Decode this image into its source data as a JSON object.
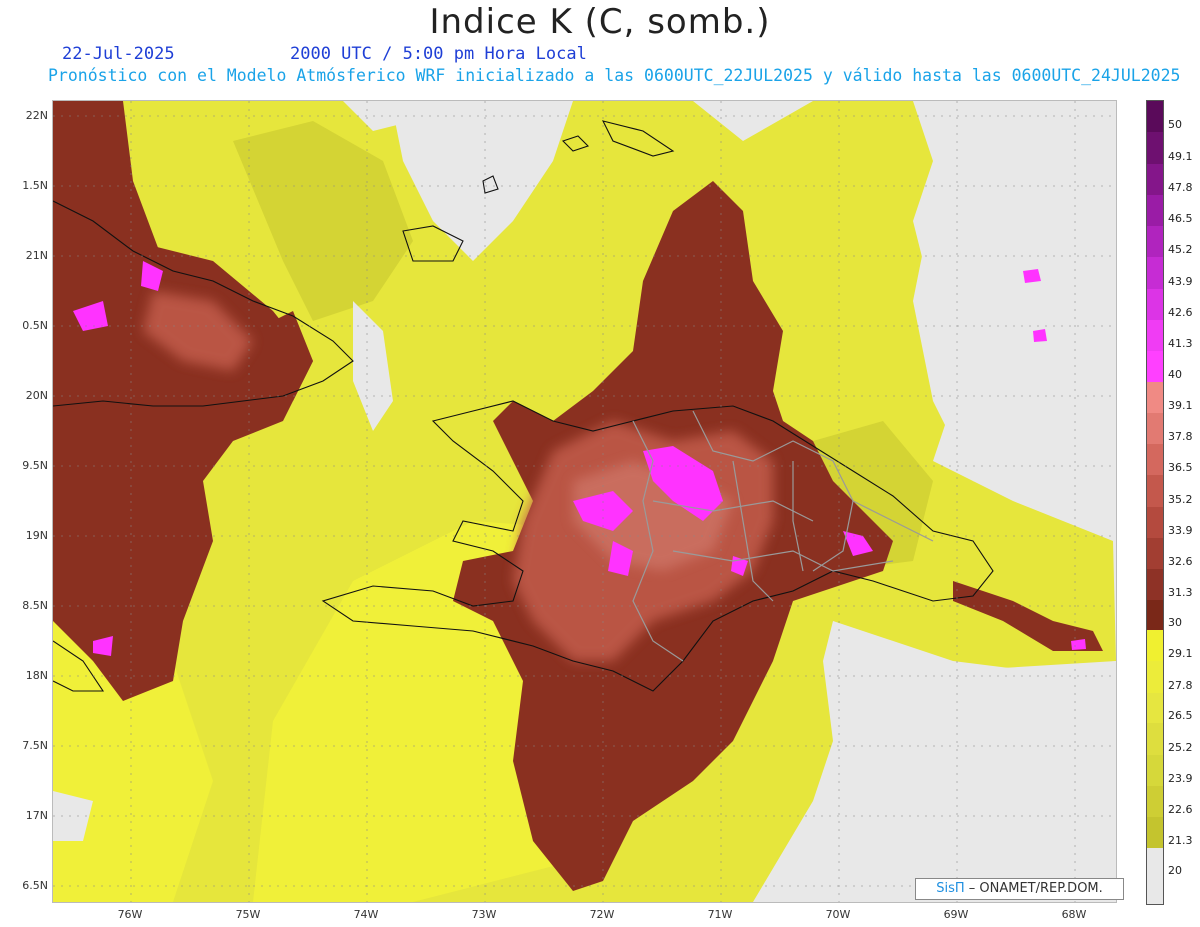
{
  "header": {
    "title": "Indice K (C, somb.)",
    "date": "22-Jul-2025",
    "time": "2000 UTC / 5:00 pm Hora Local",
    "description": "Pronóstico con el Modelo Atmósferico WRF inicializado a las 0600UTC_22JUL2025 y válido hasta las  0600UTC_24JUL2025"
  },
  "axes": {
    "lat_labels": [
      "22N",
      "1.5N",
      "21N",
      "0.5N",
      "20N",
      "9.5N",
      "19N",
      "8.5N",
      "18N",
      "7.5N",
      "17N",
      "6.5N"
    ],
    "lon_labels": [
      "76W",
      "75W",
      "74W",
      "73W",
      "72W",
      "71W",
      "70W",
      "69W",
      "68W"
    ]
  },
  "colorbar": {
    "labels": [
      "50",
      "49.1",
      "47.8",
      "46.5",
      "45.2",
      "43.9",
      "42.6",
      "41.3",
      "40",
      "39.1",
      "37.8",
      "36.5",
      "35.2",
      "33.9",
      "32.6",
      "31.3",
      "30",
      "29.1",
      "27.8",
      "26.5",
      "25.2",
      "23.9",
      "22.6",
      "21.3",
      "20"
    ],
    "colors": [
      "#5a0a5a",
      "#6e1070",
      "#84168a",
      "#9a1ca6",
      "#b024be",
      "#c62cd4",
      "#dc34e6",
      "#f03cf4",
      "#ff40ff",
      "#f08a84",
      "#e27a72",
      "#d4685e",
      "#c4584c",
      "#b44a3e",
      "#a23e32",
      "#8e3226",
      "#7a2818",
      "#f0f030",
      "#ecec3a",
      "#e6e640",
      "#dede3e",
      "#d6d83a",
      "#cece34",
      "#c4c42e",
      "#e8e8e8"
    ]
  },
  "credit": {
    "brand": "SisΠ",
    "text": " – ONAMET/REP.DOM."
  }
}
